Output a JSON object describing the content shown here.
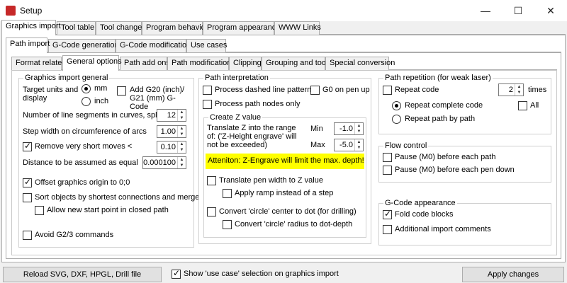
{
  "window": {
    "title": "Setup",
    "min": "—",
    "max": "☐",
    "close": "✕"
  },
  "tabs_main": [
    "Graphics import",
    "Tool table",
    "Tool change",
    "Program behavior",
    "Program appearance",
    "WWW Links"
  ],
  "tabs_sub": [
    "Path import",
    "G-Code generation",
    "G-Code modification",
    "Use cases"
  ],
  "tabs_third": [
    "Format related",
    "General options",
    "Path add ons",
    "Path modifications",
    "Clipping",
    "Grouping and tools",
    "Special conversion"
  ],
  "gen": {
    "legend": "Graphics import general",
    "target_label": "Target units and display",
    "mm": "mm",
    "inch": "inch",
    "add_g20": "Add G20 (inch)/ G21 (mm) G-Code",
    "segments": "Number of line segments in curves, splines",
    "segments_val": "12",
    "stepwidth": "Step width on circumference of arcs",
    "stepwidth_val": "1.00",
    "remove_short": "Remove very short moves <",
    "remove_short_val": "0.10",
    "distance": "Distance to be assumed as equal",
    "distance_val": "0.000100",
    "offset": "Offset graphics origin to 0;0",
    "sort": "Sort objects by shortest connections and merge",
    "allow": "Allow new start point in closed path",
    "avoid": "Avoid G2/3 commands"
  },
  "interp": {
    "legend": "Path interpretation",
    "dashed": "Process dashed line pattern",
    "g0": "G0 on pen up",
    "nodes": "Process path nodes only",
    "z_legend": "Create Z value",
    "z_text": "Translate Z into the range of: ('Z-Height engrave' will not be exceeded)",
    "min": "Min",
    "min_val": "-1.0",
    "max": "Max",
    "max_val": "-5.0",
    "warning": "Atteniton: Z-Engrave will limit the max. depth!",
    "pen_width": "Translate pen width to Z value",
    "ramp": "Apply ramp instead of a step",
    "circle": "Convert 'circle' center to dot (for drilling)",
    "circle_r": "Convert 'circle' radius to dot-depth"
  },
  "repeat": {
    "legend": "Path repetition (for weak laser)",
    "repeat_code": "Repeat code",
    "times_val": "2",
    "times": "times",
    "complete": "Repeat complete code",
    "all": "All",
    "by_path": "Repeat path by path"
  },
  "flow": {
    "legend": "Flow control",
    "pause_path": "Pause (M0) before each path",
    "pause_pen": "Pause (M0) before each pen down"
  },
  "appear": {
    "legend": "G-Code appearance",
    "fold": "Fold code blocks",
    "comments": "Additional import comments"
  },
  "footer": {
    "reload": "Reload SVG, DXF, HPGL, Drill file",
    "show_usecase": "Show 'use case' selection on graphics import",
    "apply": "Apply changes"
  }
}
